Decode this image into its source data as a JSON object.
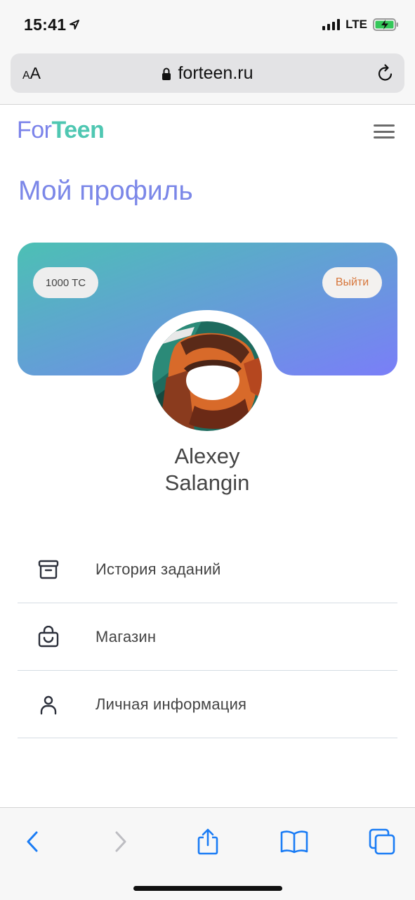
{
  "status_bar": {
    "time": "15:41",
    "network": "LTE"
  },
  "browser": {
    "text_size_small": "A",
    "text_size_large": "A",
    "url": "forteen.ru"
  },
  "header": {
    "logo_part1": "For",
    "logo_part2": "Teen"
  },
  "page": {
    "title": "Мой профиль"
  },
  "profile": {
    "balance": "1000 TC",
    "logout_label": "Выйти",
    "first_name": "Alexey",
    "last_name": "Salangin"
  },
  "menu": {
    "items": [
      {
        "label": "История заданий",
        "icon": "archive-icon"
      },
      {
        "label": "Магазин",
        "icon": "shopping-bag-icon"
      },
      {
        "label": "Личная информация",
        "icon": "user-icon"
      }
    ]
  },
  "colors": {
    "accent_purple": "#7b87e8",
    "accent_teal": "#4fc7b2",
    "logout_orange": "#d7773c",
    "card_gradient_start": "#4cc0b4",
    "card_gradient_end": "#7a7ef8",
    "ios_blue": "#1a7cf5"
  }
}
